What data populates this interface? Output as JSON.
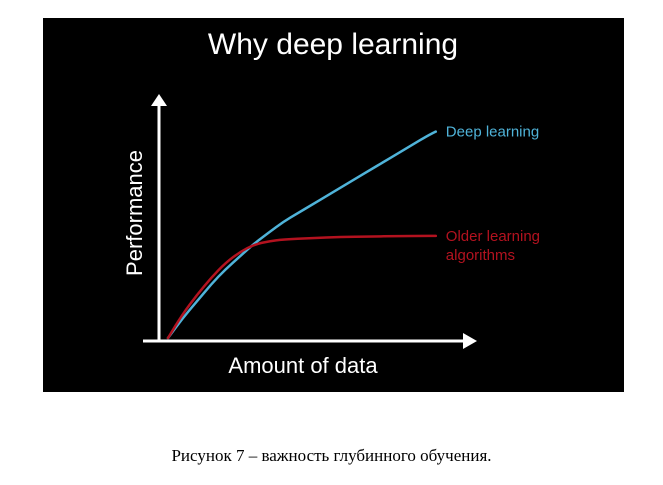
{
  "chart_data": {
    "type": "line",
    "title": "Why deep learning",
    "xlabel": "Amount of data",
    "ylabel": "Performance",
    "xlim": [
      0,
      10
    ],
    "ylim": [
      0,
      10
    ],
    "grid": false,
    "legend": "inline-right",
    "series": [
      {
        "name": "Deep learning",
        "color": "#4fb3d9",
        "x": [
          0,
          0.5,
          1,
          1.5,
          2,
          2.5,
          3,
          3.5,
          4,
          4.5,
          5,
          5.5,
          6,
          6.5,
          7,
          7.5,
          8,
          8.5,
          9,
          9.3
        ],
        "y": [
          0,
          0.9,
          1.7,
          2.5,
          3.2,
          3.8,
          4.4,
          4.9,
          5.4,
          5.8,
          6.2,
          6.6,
          7.0,
          7.4,
          7.8,
          8.2,
          8.6,
          9.0,
          9.4,
          9.6
        ]
      },
      {
        "name": "Older learning\nalgorithms",
        "color": "#b3121f",
        "x": [
          0,
          0.5,
          1,
          1.5,
          2,
          2.5,
          3,
          3.5,
          4,
          5,
          6,
          7,
          8,
          9,
          9.3
        ],
        "y": [
          0,
          1.1,
          2.0,
          2.8,
          3.5,
          4.0,
          4.35,
          4.5,
          4.58,
          4.65,
          4.7,
          4.72,
          4.74,
          4.75,
          4.75
        ]
      }
    ]
  },
  "caption": "Рисунок 7 – важность глубинного обучения."
}
